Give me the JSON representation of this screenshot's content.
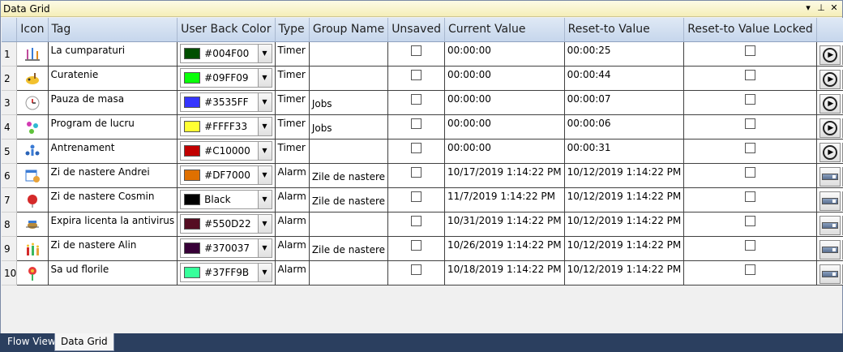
{
  "window": {
    "title": "Data Grid"
  },
  "columns": [
    "Icon",
    "Tag",
    "User Back Color",
    "Type",
    "Group Name",
    "Unsaved",
    "Current Value",
    "Reset-to Value",
    "Reset-to Value Locked"
  ],
  "rows": [
    {
      "num": "1",
      "icon": "shopping-icon",
      "tag": "La cumparaturi",
      "color_label": "#004F00",
      "color": "#004F00",
      "type": "Timer",
      "group": "",
      "current": "00:00:00",
      "reset": "00:00:25",
      "action": "play"
    },
    {
      "num": "2",
      "icon": "cleaning-icon",
      "tag": "Curatenie",
      "color_label": "#09FF09",
      "color": "#09FF09",
      "type": "Timer",
      "group": "",
      "current": "00:00:00",
      "reset": "00:00:44",
      "action": "play"
    },
    {
      "num": "3",
      "icon": "clock-icon",
      "tag": "Pauza de masa",
      "color_label": "#3535FF",
      "color": "#3535FF",
      "type": "Timer",
      "group": "Jobs",
      "current": "00:00:00",
      "reset": "00:00:07",
      "action": "play"
    },
    {
      "num": "4",
      "icon": "molecule-icon",
      "tag": "Program de lucru",
      "color_label": "#FFFF33",
      "color": "#FFFF33",
      "type": "Timer",
      "group": "Jobs",
      "current": "00:00:00",
      "reset": "00:00:06",
      "action": "play"
    },
    {
      "num": "5",
      "icon": "fitness-icon",
      "tag": "Antrenament",
      "color_label": "#C10000",
      "color": "#C10000",
      "type": "Timer",
      "group": "",
      "current": "00:00:00",
      "reset": "00:00:31",
      "action": "play"
    },
    {
      "num": "6",
      "icon": "calendar-person-icon",
      "tag": "Zi de nastere Andrei",
      "color_label": "#DF7000",
      "color": "#DF7000",
      "type": "Alarm",
      "group": "Zile de nastere",
      "current": "10/17/2019 1:14:22 PM",
      "reset": "10/12/2019 1:14:22 PM",
      "action": "slider"
    },
    {
      "num": "7",
      "icon": "balloon-icon",
      "tag": "Zi de nastere Cosmin",
      "color_label": "Black",
      "color": "#000000",
      "type": "Alarm",
      "group": "Zile de nastere",
      "current": "11/7/2019 1:14:22 PM",
      "reset": "10/12/2019 1:14:22 PM",
      "action": "slider"
    },
    {
      "num": "8",
      "icon": "bug-icon",
      "tag": "Expira licenta la antivirus",
      "color_label": "#550D22",
      "color": "#550D22",
      "type": "Alarm",
      "group": "",
      "current": "10/31/2019 1:14:22 PM",
      "reset": "10/12/2019 1:14:22 PM",
      "action": "slider"
    },
    {
      "num": "9",
      "icon": "candles-icon",
      "tag": "Zi de nastere Alin",
      "color_label": "#370037",
      "color": "#370037",
      "type": "Alarm",
      "group": "Zile de nastere",
      "current": "10/26/2019 1:14:22 PM",
      "reset": "10/12/2019 1:14:22 PM",
      "action": "slider"
    },
    {
      "num": "10",
      "icon": "flower-icon",
      "tag": "Sa ud florile",
      "color_label": "#37FF9B",
      "color": "#37FF9B",
      "type": "Alarm",
      "group": "",
      "current": "10/18/2019 1:14:22 PM",
      "reset": "10/12/2019 1:14:22 PM",
      "action": "slider"
    }
  ],
  "tabs": [
    {
      "label": "Flow View",
      "active": false
    },
    {
      "label": "Data Grid",
      "active": true
    }
  ],
  "colors": {
    "delete": "#D90000",
    "header_top": "#DFE9F5",
    "header_bottom": "#C6D6EC",
    "titlebar": "#F5EEB8",
    "frame": "#2B3F5F"
  }
}
